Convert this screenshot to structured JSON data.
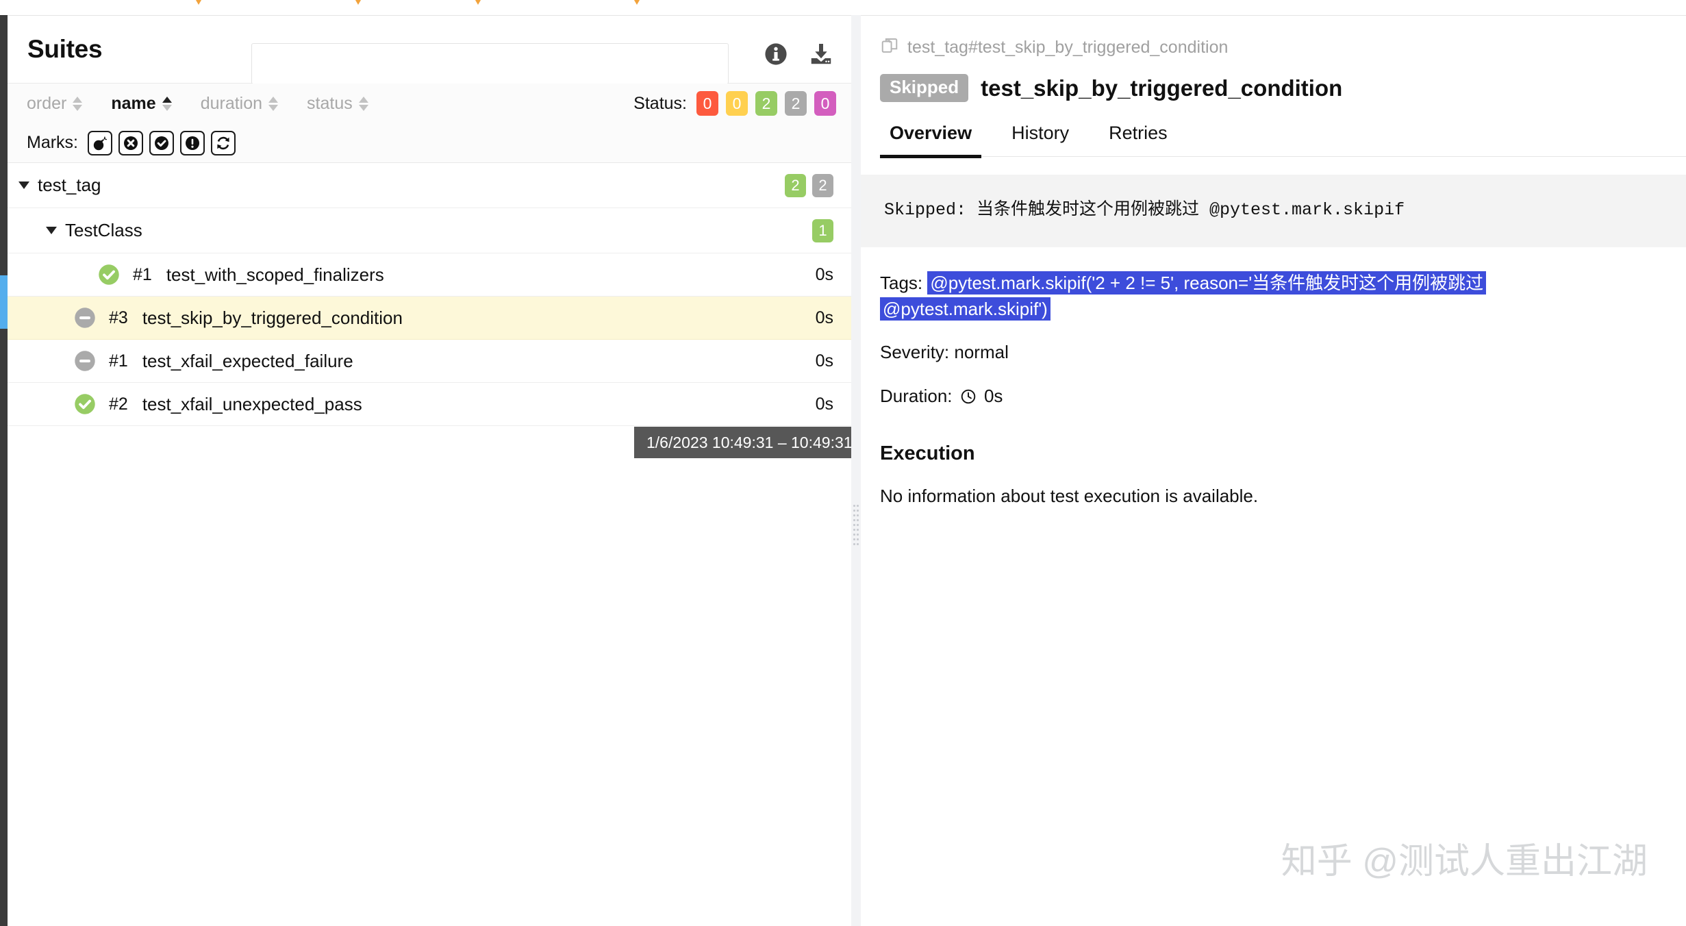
{
  "top_chevrons": [
    290,
    523,
    698,
    930
  ],
  "left_panel": {
    "title": "Suites",
    "search_placeholder": "",
    "search_value": "",
    "info_icon": "info-circle-icon",
    "download_icon": "download-icon",
    "sort": {
      "columns": [
        {
          "label": "order",
          "active": false,
          "dir": "none"
        },
        {
          "label": "name",
          "active": true,
          "dir": "asc"
        },
        {
          "label": "duration",
          "active": false,
          "dir": "none"
        },
        {
          "label": "status",
          "active": false,
          "dir": "none"
        }
      ]
    },
    "status": {
      "label": "Status:",
      "chips": [
        {
          "value": "0",
          "color": "#fd5a3e"
        },
        {
          "value": "0",
          "color": "#ffd050"
        },
        {
          "value": "2",
          "color": "#97cc64"
        },
        {
          "value": "2",
          "color": "#aaaaaa"
        },
        {
          "value": "0",
          "color": "#d35ebe"
        }
      ]
    },
    "marks": {
      "label": "Marks:",
      "buttons": [
        {
          "icon": "bomb-icon",
          "name": "mark-flaky"
        },
        {
          "icon": "x-circle-icon",
          "name": "mark-failed"
        },
        {
          "icon": "check-circle-icon",
          "name": "mark-passed"
        },
        {
          "icon": "exclamation-circle-icon",
          "name": "mark-broken"
        },
        {
          "icon": "retry-icon",
          "name": "mark-retry"
        }
      ]
    },
    "tree": {
      "suite": {
        "name": "test_tag",
        "badges": [
          {
            "value": "2",
            "color": "#97cc64"
          },
          {
            "value": "2",
            "color": "#aaaaaa"
          }
        ]
      },
      "class": {
        "name": "TestClass",
        "badges": [
          {
            "value": "1",
            "color": "#97cc64"
          }
        ]
      },
      "tests": [
        {
          "status": "passed",
          "order": "#1",
          "name": "test_with_scoped_finalizers",
          "duration": "0s",
          "selected": false,
          "indent": 131
        },
        {
          "status": "skipped",
          "order": "#3",
          "name": "test_skip_by_triggered_condition",
          "duration": "0s",
          "selected": true,
          "indent": 96
        },
        {
          "status": "skipped",
          "order": "#1",
          "name": "test_xfail_expected_failure",
          "duration": "0s",
          "selected": false,
          "indent": 96
        },
        {
          "status": "passed",
          "order": "#2",
          "name": "test_xfail_unexpected_pass",
          "duration": "0s",
          "selected": false,
          "indent": 96
        }
      ]
    },
    "tooltip": "1/6/2023 10:49:31 – 10:49:31"
  },
  "right_panel": {
    "breadcrumb": "test_tag#test_skip_by_triggered_condition",
    "breadcrumb_icon": "copy-documents-icon",
    "status_badge": "Skipped",
    "status_badge_color": "#aaaaaa",
    "title": "test_skip_by_triggered_condition",
    "tabs": [
      {
        "label": "Overview",
        "active": true
      },
      {
        "label": "History",
        "active": false
      },
      {
        "label": "Retries",
        "active": false
      }
    ],
    "message": "Skipped: 当条件触发时这个用例被跳过  @pytest.mark.skipif",
    "tags_label": "Tags:",
    "tags_value": "@pytest.mark.skipif('2 + 2 != 5', reason='当条件触发时这个用例被跳过 @pytest.mark.skipif')",
    "tags_highlight_color": "#3d4ddb",
    "severity_label": "Severity:",
    "severity_value": "normal",
    "duration_label": "Duration:",
    "duration_icon": "clock-icon",
    "duration_value": "0s",
    "execution_heading": "Execution",
    "execution_text": "No information about test execution is available."
  },
  "watermark": "知乎 @测试人重出江湖"
}
